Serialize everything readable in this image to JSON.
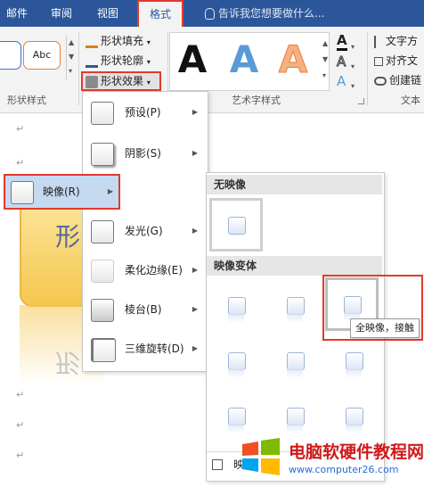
{
  "tabs": [
    {
      "label": "邮件"
    },
    {
      "label": "审阅"
    },
    {
      "label": "视图"
    },
    {
      "label": "格式",
      "active": true
    }
  ],
  "tell_me": {
    "placeholder": "告诉我您想要做什么..."
  },
  "ribbon": {
    "shape_style_sample": "Abc",
    "shape_fill": "形状填充",
    "shape_outline": "形状轮廓",
    "shape_effect": "形状效果",
    "group_shape_styles": "形状样式",
    "group_art_styles": "艺术字样式",
    "group_text": "文本",
    "text_direction": "文字方",
    "align_text": "对齐文",
    "create_link": "创建链",
    "art_letter": "A"
  },
  "document": {
    "shape_text": "形",
    "para_mark": "↵"
  },
  "menu": {
    "items": [
      {
        "label": "预设(P)"
      },
      {
        "label": "阴影(S)"
      },
      {
        "label": "映像(R)",
        "highlighted": true
      },
      {
        "label": "发光(G)"
      },
      {
        "label": "柔化边缘(E)"
      },
      {
        "label": "棱台(B)"
      },
      {
        "label": "三维旋转(D)"
      }
    ]
  },
  "submenu": {
    "no_reflection": "无映像",
    "variants": "映像变体",
    "footer_checkbox": "映",
    "tooltip": "全映像，接触"
  },
  "watermark": {
    "text": "电脑软硬件教程网",
    "url": "www.computer26.com"
  },
  "colors": {
    "tab_bar": "#2b579a",
    "highlight_red": "#e23a2e",
    "menu_hover": "#c5d9f1",
    "shape_fill": "#fcd97b"
  }
}
